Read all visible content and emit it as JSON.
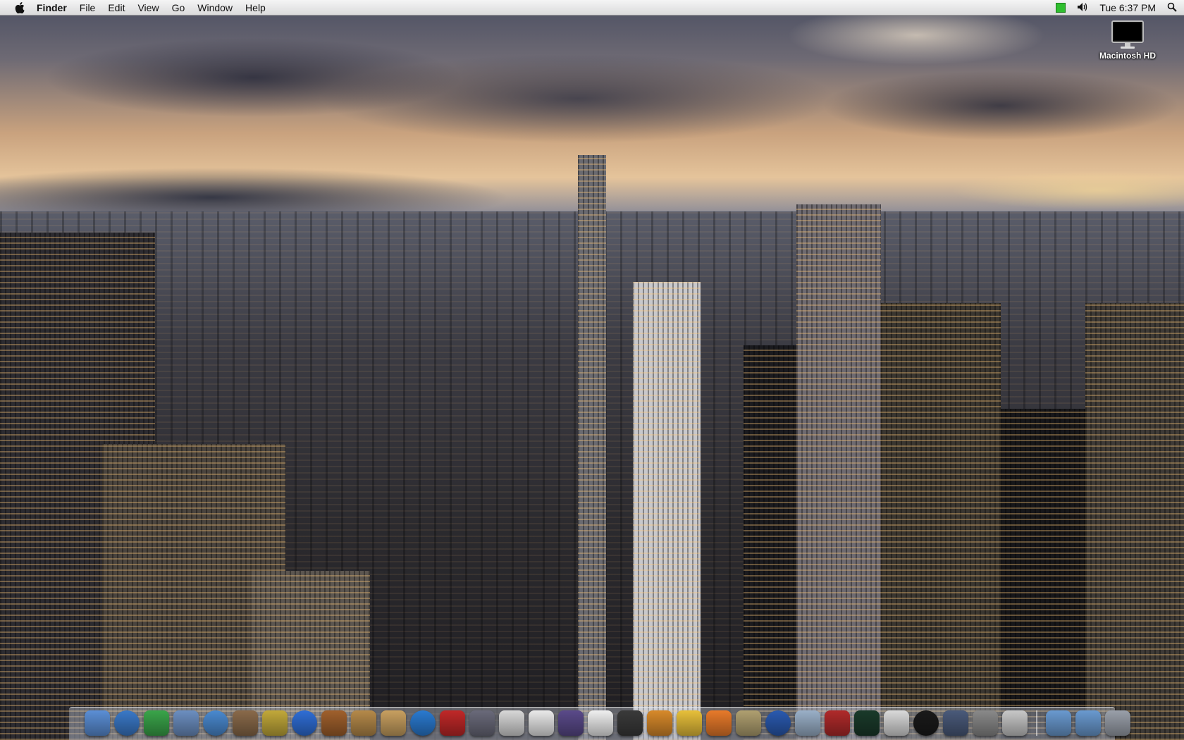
{
  "menubar": {
    "app_name": "Finder",
    "menus": [
      "File",
      "Edit",
      "View",
      "Go",
      "Window",
      "Help"
    ],
    "clock": "Tue 6:37 PM",
    "icons": [
      "apple-icon",
      "battery-icon",
      "volume-icon",
      "spotlight-icon"
    ]
  },
  "desktop": {
    "icons": [
      {
        "label": "Macintosh HD",
        "icon": "hard-drive-icon"
      }
    ]
  },
  "dock": {
    "apps": [
      {
        "name": "finder-icon",
        "color": "#5b8fd6"
      },
      {
        "name": "safari-icon",
        "color": "#3a79c8"
      },
      {
        "name": "ichat-icon",
        "color": "#3aa54a"
      },
      {
        "name": "mail-stamp-icon",
        "color": "#6c8fc1"
      },
      {
        "name": "itunes-icon",
        "color": "#4a8ad0"
      },
      {
        "name": "iphoto-icon",
        "color": "#8a6a4a"
      },
      {
        "name": "imovie-icon",
        "color": "#c2a93a"
      },
      {
        "name": "idvd-icon",
        "color": "#2f6ed6"
      },
      {
        "name": "garageband-icon",
        "color": "#a0602c"
      },
      {
        "name": "preview-icon",
        "color": "#b58a4a"
      },
      {
        "name": "address-book-icon",
        "color": "#c8a060"
      },
      {
        "name": "quicktime-icon",
        "color": "#2a7ad0"
      },
      {
        "name": "photo-booth-icon",
        "color": "#c02828"
      },
      {
        "name": "automator-icon",
        "color": "#6a6a7a"
      },
      {
        "name": "ical-icon",
        "color": "#d8d8d8"
      },
      {
        "name": "textedit-icon",
        "color": "#eaeaea"
      },
      {
        "name": "front-row-icon",
        "color": "#5a4a8a"
      },
      {
        "name": "coffee-icon",
        "color": "#f0f0f0"
      },
      {
        "name": "terminal-icon",
        "color": "#3a3a3a"
      },
      {
        "name": "cocktail-icon",
        "color": "#d88a2a"
      },
      {
        "name": "hairdryer-icon",
        "color": "#e8c03a"
      },
      {
        "name": "umbrella-icon",
        "color": "#e87a2a"
      },
      {
        "name": "cog-icon",
        "color": "#b0a070"
      },
      {
        "name": "google-earth-icon",
        "color": "#2a5ab0"
      },
      {
        "name": "system-profiler-icon",
        "color": "#9ab0c8"
      },
      {
        "name": "dictionary-icon",
        "color": "#b02a2a"
      },
      {
        "name": "activity-monitor-icon",
        "color": "#1a3a2a"
      },
      {
        "name": "printer-icon",
        "color": "#dadada"
      },
      {
        "name": "dashboard-icon",
        "color": "#1a1a1a"
      },
      {
        "name": "expose-icon",
        "color": "#4a5a7a"
      },
      {
        "name": "system-preferences-icon",
        "color": "#8a8a8a"
      },
      {
        "name": "script-icon",
        "color": "#c8c8c8"
      }
    ],
    "stacks": [
      {
        "name": "applications-folder-icon",
        "color": "#6a9ad0"
      },
      {
        "name": "downloads-folder-icon",
        "color": "#6a9ad0"
      },
      {
        "name": "trash-icon",
        "color": "#9aa0aa"
      }
    ]
  }
}
